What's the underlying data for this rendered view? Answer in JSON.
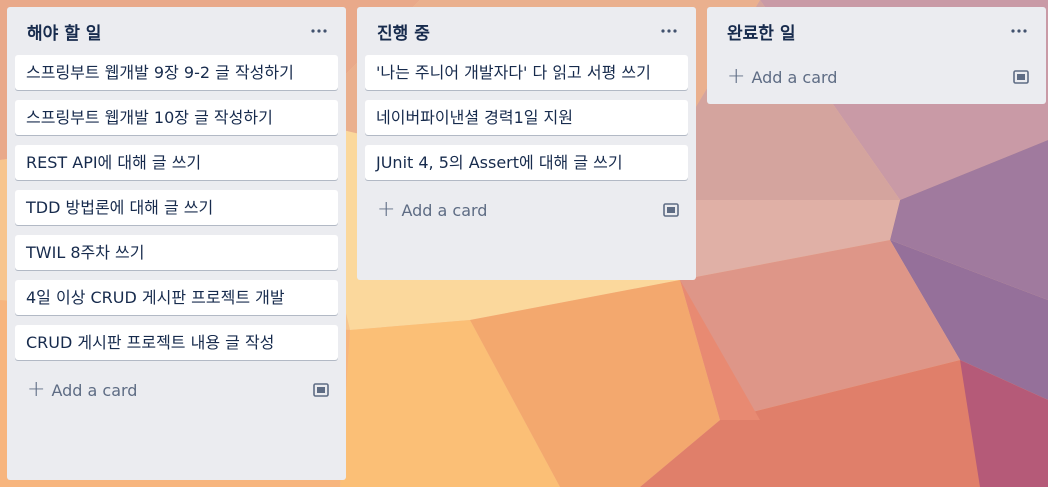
{
  "board": {
    "lists": [
      {
        "title": "해야 할 일",
        "menu_icon": "ellipsis-icon",
        "cards": [
          "스프링부트 웹개발 9장 9-2 글 작성하기",
          "스프링부트 웹개발 10장 글 작성하기",
          "REST API에 대해 글 쓰기",
          "TDD 방법론에 대해 글 쓰기",
          "TWIL 8주차 쓰기",
          "4일 이상 CRUD 게시판 프로젝트 개발",
          "CRUD 게시판 프로젝트 내용 글 작성"
        ],
        "add_label": "Add a card"
      },
      {
        "title": "진행 중",
        "menu_icon": "ellipsis-icon",
        "cards": [
          "'나는 주니어 개발자다' 다 읽고 서평 쓰기",
          "네이버파이낸셜 경력1일 지원",
          "JUnit 4, 5의 Assert에 대해 글 쓰기"
        ],
        "add_label": "Add a card"
      },
      {
        "title": "완료한 일",
        "menu_icon": "ellipsis-icon",
        "cards": [],
        "add_label": "Add a card"
      }
    ]
  },
  "icons": {
    "menu": "ellipsis-icon",
    "add": "plus-icon",
    "template": "card-template-icon"
  },
  "colors": {
    "list_bg": "#ebecf0",
    "card_bg": "#ffffff",
    "title_text": "#172b4d",
    "muted_text": "#5e6c84"
  }
}
